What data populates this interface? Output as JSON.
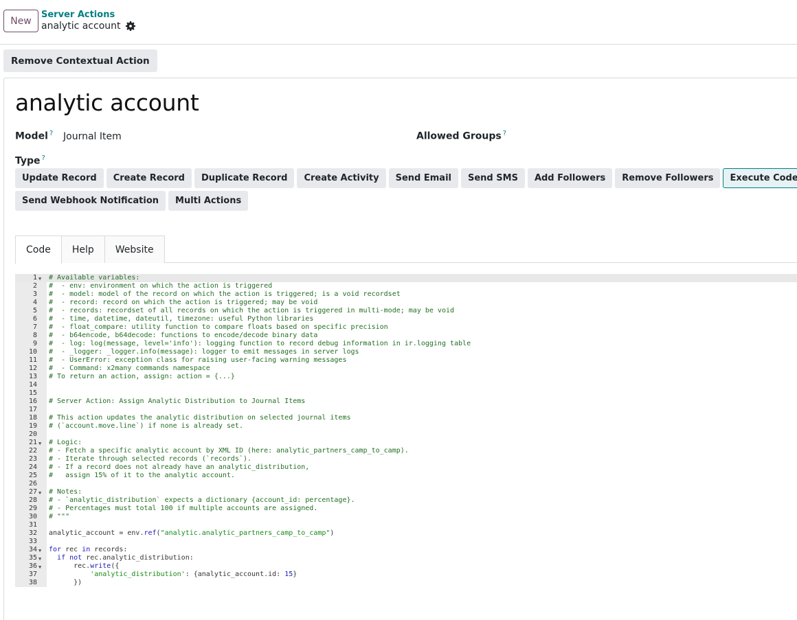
{
  "control_panel": {
    "new_button": "New",
    "breadcrumb_parent": "Server Actions",
    "breadcrumb_current": "analytic account"
  },
  "action_bar": {
    "remove_contextual": "Remove Contextual Action"
  },
  "form": {
    "title": "analytic account",
    "model_label": "Model",
    "model_value": "Journal Item",
    "allowed_groups_label": "Allowed Groups",
    "type_label": "Type",
    "help_marker": "?",
    "type_buttons_row1": [
      "Update Record",
      "Create Record",
      "Duplicate Record",
      "Create Activity",
      "Send Email",
      "Send SMS",
      "Add Followers",
      "Remove Followers",
      "Execute Code"
    ],
    "type_buttons_row2": [
      "Send Webhook Notification",
      "Multi Actions"
    ],
    "selected_type": "Execute Code"
  },
  "tabs": [
    "Code",
    "Help",
    "Website"
  ],
  "active_tab": "Code",
  "code_lines": [
    "# Available variables:",
    "#  - env: environment on which the action is triggered",
    "#  - model: model of the record on which the action is triggered; is a void recordset",
    "#  - record: record on which the action is triggered; may be void",
    "#  - records: recordset of all records on which the action is triggered in multi-mode; may be void",
    "#  - time, datetime, dateutil, timezone: useful Python libraries",
    "#  - float_compare: utility function to compare floats based on specific precision",
    "#  - b64encode, b64decode: functions to encode/decode binary data",
    "#  - log: log(message, level='info'): logging function to record debug information in ir.logging table",
    "#  - _logger: _logger.info(message): logger to emit messages in server logs",
    "#  - UserError: exception class for raising user-facing warning messages",
    "#  - Command: x2many commands namespace",
    "# To return an action, assign: action = {...}",
    "",
    "",
    "# Server Action: Assign Analytic Distribution to Journal Items",
    "",
    "# This action updates the analytic distribution on selected journal items",
    "# (`account.move.line`) if none is already set.",
    "",
    "# Logic:",
    "# - Fetch a specific analytic account by XML ID (here: analytic_partners_camp_to_camp).",
    "# - Iterate through selected records (`records`).",
    "# - If a record does not already have an analytic_distribution,",
    "#   assign 15% of it to the analytic account.",
    "",
    "# Notes:",
    "# - `analytic_distribution` expects a dictionary {account_id: percentage}.",
    "# - Percentages must total 100 if multiple accounts are assigned.",
    "# \"\"\"",
    "",
    "analytic_account = env.ref(\"analytic.analytic_partners_camp_to_camp\")",
    "",
    "for rec in records:",
    "  if not rec.analytic_distribution:",
    "      rec.write({",
    "          'analytic_distribution': {analytic_account.id: 15}",
    "      })"
  ],
  "fold_lines": [
    1,
    21,
    27,
    34,
    35,
    36
  ]
}
